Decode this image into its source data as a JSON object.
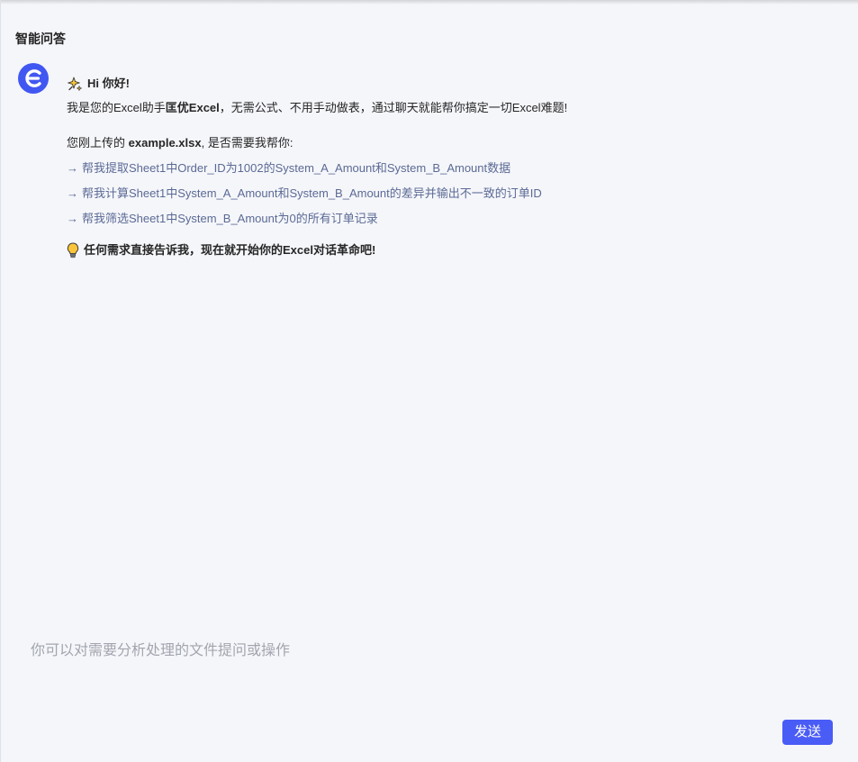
{
  "header": {
    "title": "智能问答"
  },
  "assistant": {
    "avatar_icon": "excel-e-logo-icon"
  },
  "message": {
    "greeting_icon": "sparkle-icon",
    "greeting": "Hi 你好!",
    "intro": {
      "prefix": "我是您的Excel助手",
      "name": "匡优Excel",
      "suffix": "，无需公式、不用手动做表，通过聊天就能帮你搞定一切Excel难题!"
    },
    "upload": {
      "prefix": "您刚上传的 ",
      "filename": "example.xlsx",
      "suffix": ", 是否需要我帮你:"
    },
    "suggestion_arrow": "→",
    "suggestions": [
      "帮我提取Sheet1中Order_ID为1002的System_A_Amount和System_B_Amount数据",
      "帮我计算Sheet1中System_A_Amount和System_B_Amount的差异并输出不一致的订单ID",
      "帮我筛选Sheet1中System_B_Amount为0的所有订单记录"
    ],
    "closing_icon": "lightbulb-icon",
    "closing": "任何需求直接告诉我，现在就开始你的Excel对话革命吧!"
  },
  "composer": {
    "placeholder": "你可以对需要分析处理的文件提问或操作",
    "value": ""
  },
  "send_button": {
    "label": "发送"
  },
  "colors": {
    "background": "#f5f6fa",
    "accent": "#4a5cf6",
    "suggestion_text": "#5b6a95",
    "placeholder_text": "#a2a5ae",
    "body_text": "#262626"
  }
}
